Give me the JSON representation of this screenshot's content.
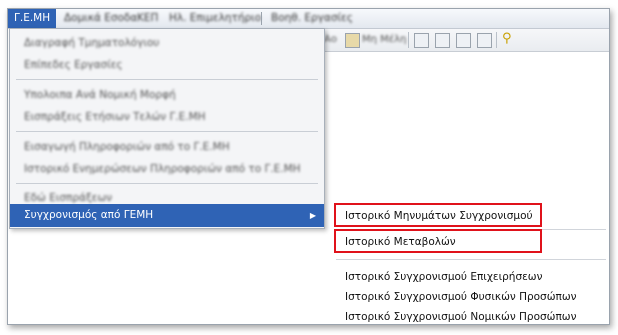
{
  "menubar": {
    "items": [
      {
        "label": "Γ.Ε.ΜΗ"
      },
      {
        "label": "Δομικά Εσοδα"
      },
      {
        "label": "ΚΕΠ"
      },
      {
        "label": "Ηλ. Επιμελητήριο"
      },
      {
        "label": "Βοηθ. Εργασίες"
      }
    ]
  },
  "toolbar": {
    "items": [
      {
        "label": "Αο"
      },
      {
        "label": "Μη Μέλη"
      }
    ],
    "icons": [
      "list-icon",
      "copy-icon",
      "copy-icon",
      "copy-icon",
      "key-icon"
    ]
  },
  "dropdown": {
    "items": [
      {
        "label": "Διαγραφή Τμηματολόγιου"
      },
      {
        "label": "Επίπεδες Εργασίες"
      },
      {
        "label": "Υπολοιπα Ανά Νομική Μορφή"
      },
      {
        "label": "Εισπράξεις Ετήσιων Τελών Γ.Ε.ΜΗ"
      },
      {
        "label": "Εισαγωγή Πληροφοριών από το Γ.Ε.ΜΗ"
      },
      {
        "label": "Ιστορικό Ενημερώσεων Πληροφοριών από το Γ.Ε.ΜΗ"
      },
      {
        "label": "Εδώ Εισπράξεων"
      },
      {
        "label": "Συγχρονισμός από ΓΕΜΗ"
      }
    ]
  },
  "submenu": {
    "items": [
      {
        "label": "Ιστορικό Μηνυμάτων Συγχρονισμού"
      },
      {
        "label": "Ιστορικό Μεταβολών"
      },
      {
        "label": "Ιστορικό Συγχρονισμού Επιχειρήσεων"
      },
      {
        "label": "Ιστορικό Συγχρονισμού Φυσικών Προσώπων"
      },
      {
        "label": "Ιστορικό Συγχρονισμού Νομικών Προσώπων"
      }
    ]
  },
  "colors": {
    "highlight": "#2f63b5",
    "annotation_border": "#e0121b"
  }
}
